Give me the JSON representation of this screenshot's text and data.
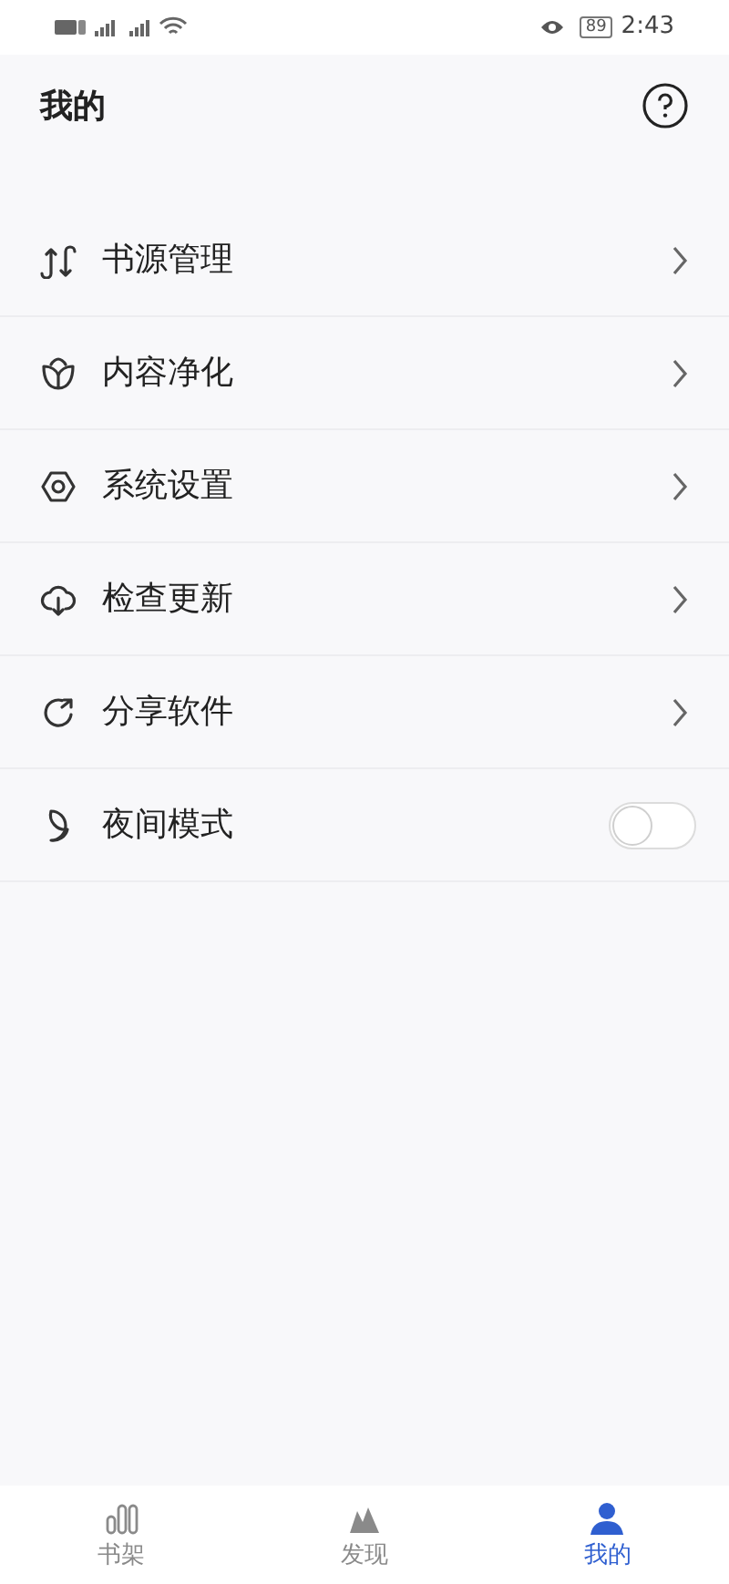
{
  "status_bar": {
    "battery": "89",
    "time": "2:43"
  },
  "header": {
    "title": "我的"
  },
  "menu": [
    {
      "kind": "link",
      "label": "书源管理"
    },
    {
      "kind": "link",
      "label": "内容净化"
    },
    {
      "kind": "link",
      "label": "系统设置"
    },
    {
      "kind": "link",
      "label": "检查更新"
    },
    {
      "kind": "link",
      "label": "分享软件"
    },
    {
      "kind": "toggle",
      "label": "夜间模式",
      "on": false
    }
  ],
  "tab_bar": [
    {
      "label": "书架",
      "selected": false
    },
    {
      "label": "发现",
      "selected": false
    },
    {
      "label": "我的",
      "selected": true
    }
  ]
}
